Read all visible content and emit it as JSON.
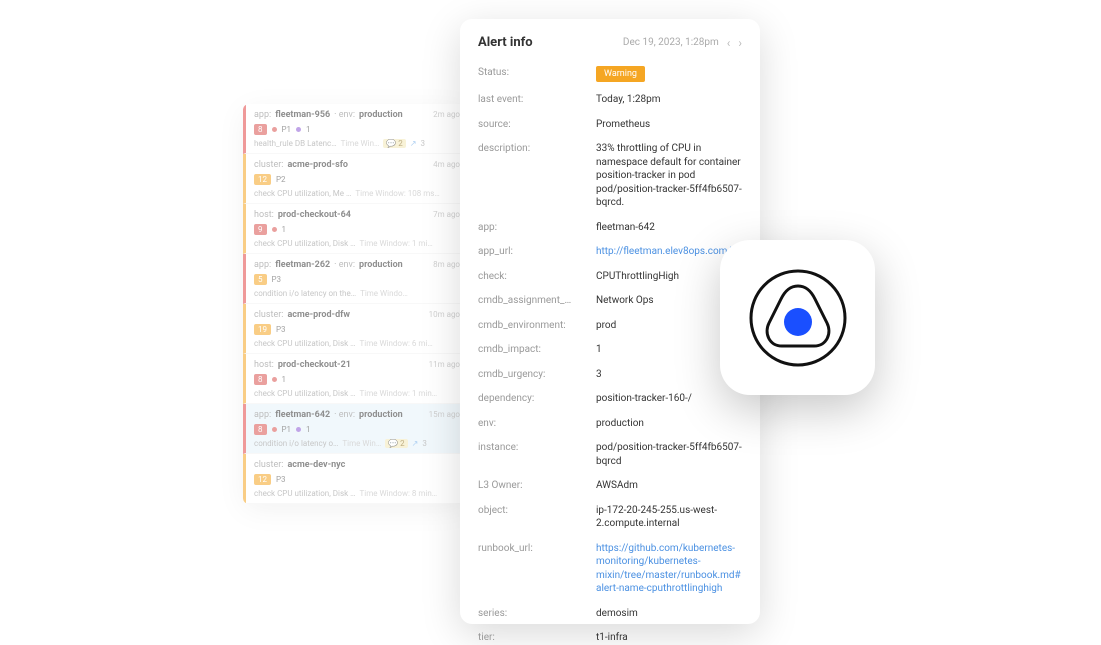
{
  "alerts": [
    {
      "color": "red",
      "key1": "app:",
      "val1": "fleetman-956",
      "key2": "env:",
      "val2": "production",
      "time": "2m ago",
      "badge": "8",
      "bclass": "b8",
      "pdot": "red",
      "plabel": "P1",
      "extra_dot": "purple",
      "count": "1",
      "r3a": "health_rule DB Latenc…",
      "r3b": "Time Win…",
      "chip": "2",
      "share": "3"
    },
    {
      "color": "orange",
      "key1": "cluster:",
      "val1": "acme-prod-sfo",
      "key2": "",
      "val2": "",
      "time": "4m ago",
      "badge": "12",
      "bclass": "b12",
      "pdot": "",
      "plabel": "P2",
      "extra_dot": "",
      "count": "",
      "r3a": "check CPU utilization, Me …",
      "r3b": "Time Window: 108 ms…",
      "chip": "",
      "share": ""
    },
    {
      "color": "orange",
      "key1": "host:",
      "val1": "prod-checkout-64",
      "key2": "",
      "val2": "",
      "time": "7m ago",
      "badge": "9",
      "bclass": "b9",
      "pdot": "red",
      "plabel": "",
      "extra_dot": "",
      "count": "1",
      "r3a": "check CPU utilization, Disk …",
      "r3b": "Time Window: 1 mi…",
      "chip": "",
      "share": ""
    },
    {
      "color": "red",
      "key1": "app:",
      "val1": "fleetman-262",
      "key2": "env:",
      "val2": "production",
      "time": "8m ago",
      "badge": "5",
      "bclass": "b5",
      "pdot": "",
      "plabel": "P3",
      "extra_dot": "",
      "count": "",
      "r3a": "condition i/o latency on the…",
      "r3b": "Time Windo…",
      "chip": "",
      "share": ""
    },
    {
      "color": "orange",
      "key1": "cluster:",
      "val1": "acme-prod-dfw",
      "key2": "",
      "val2": "",
      "time": "10m ago",
      "badge": "19",
      "bclass": "b19",
      "pdot": "",
      "plabel": "P3",
      "extra_dot": "",
      "count": "",
      "r3a": "check CPU utilization, Disk …",
      "r3b": "Time Window: 6 mi…",
      "chip": "",
      "share": ""
    },
    {
      "color": "orange",
      "key1": "host:",
      "val1": "prod-checkout-21",
      "key2": "",
      "val2": "",
      "time": "11m ago",
      "badge": "8",
      "bclass": "b8",
      "pdot": "red",
      "plabel": "",
      "extra_dot": "",
      "count": "1",
      "r3a": "check CPU utilization, Disk …",
      "r3b": "Time Window: 1 min…",
      "chip": "",
      "share": ""
    },
    {
      "color": "red",
      "key1": "app:",
      "val1": "fleetman-642",
      "key2": "env:",
      "val2": "production",
      "time": "15m ago",
      "badge": "8",
      "bclass": "b8",
      "pdot": "red",
      "plabel": "P1",
      "extra_dot": "purple",
      "count": "1",
      "r3a": "condition i/o latency o…",
      "r3b": "Time Win…",
      "chip": "2",
      "share": "3",
      "selected": true
    },
    {
      "color": "orange",
      "key1": "cluster:",
      "val1": "acme-dev-nyc",
      "key2": "",
      "val2": "",
      "time": "",
      "badge": "12",
      "bclass": "b12",
      "pdot": "",
      "plabel": "P3",
      "extra_dot": "",
      "count": "",
      "r3a": "check CPU utilization, Disk …",
      "r3b": "Time Window: 8 min…",
      "chip": "",
      "share": ""
    }
  ],
  "detail": {
    "title": "Alert info",
    "date": "Dec 19, 2023, 1:28pm",
    "fields": [
      {
        "k": "Status:",
        "v": "Warning",
        "type": "status"
      },
      {
        "k": "last event:",
        "v": "Today, 1:28pm"
      },
      {
        "k": "source:",
        "v": "Prometheus"
      },
      {
        "k": "description:",
        "v": "33% throttling of CPU in namespace default for container position-tracker in pod pod/position-tracker-5ff4fb6507-bqrcd."
      },
      {
        "k": "app:",
        "v": "fleetman-642"
      },
      {
        "k": "app_url:",
        "v": "http://fleetman.elev8ops.com/",
        "type": "link"
      },
      {
        "k": "check:",
        "v": "CPUThrottlingHigh"
      },
      {
        "k": "cmdb_assignment_…",
        "v": "Network Ops"
      },
      {
        "k": "cmdb_environment:",
        "v": "prod"
      },
      {
        "k": "cmdb_impact:",
        "v": "1"
      },
      {
        "k": "cmdb_urgency:",
        "v": "3"
      },
      {
        "k": "dependency:",
        "v": "position-tracker-160-/"
      },
      {
        "k": "env:",
        "v": "production"
      },
      {
        "k": "instance:",
        "v": "pod/position-tracker-5ff4fb6507-bqrcd"
      },
      {
        "k": "L3 Owner:",
        "v": "AWSAdm"
      },
      {
        "k": "object:",
        "v": "ip-172-20-245-255.us-west-2.compute.internal"
      },
      {
        "k": "runbook_url:",
        "v": "https://github.com/kubernetes-monitoring/kubernetes-mixin/tree/master/runbook.md#alert-name-cputhrottlinghigh",
        "type": "link"
      },
      {
        "k": "series:",
        "v": "demosim"
      },
      {
        "k": "tier:",
        "v": "t1-infra"
      }
    ]
  }
}
